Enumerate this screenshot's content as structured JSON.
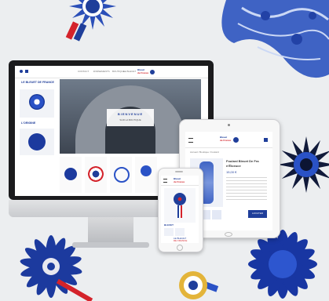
{
  "brand": {
    "name_line1": "LE BLEUET",
    "name_line2": "DE FRANCE",
    "logo_line1": "Bleuet",
    "logo_line2": "de France"
  },
  "desktop": {
    "nav_items": [
      "LE BLEUET",
      "BOUTIQUE",
      "ÉVÉNEMENTS",
      "CONTACT"
    ],
    "sidebar_title": "LE BLEUET DE FRANCE",
    "sidebar_heading": "L'ORIGINE",
    "hero_title": "BIENVENUE",
    "hero_subtitle": "SUR LA BOUTIQUE"
  },
  "tablet": {
    "breadcrumb": "Accueil / Boutique / Foulard",
    "product_title_line1": "Foulard Bleuet De Fra",
    "product_title_line2": "n'Éloeuce",
    "product_price": "15,00 €",
    "button_label": "AJOUTER"
  },
  "phone": {
    "product_label": "BLEUET",
    "footer_line1": "LE BLEUET",
    "footer_line2": "DE FRANCE"
  },
  "colors": {
    "brand_blue": "#1f3e9a",
    "brand_red": "#d4232b",
    "accent_blue": "#3b6bd6"
  }
}
